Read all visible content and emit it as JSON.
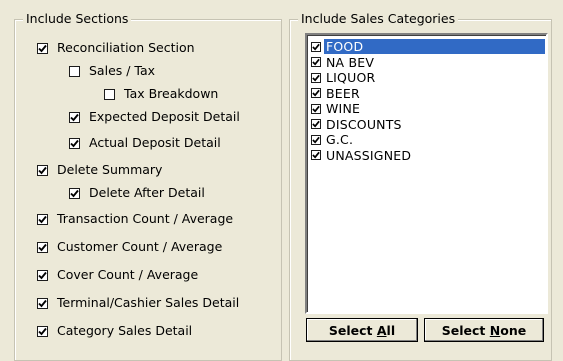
{
  "sections_group": {
    "title": "Include Sections",
    "items": [
      {
        "label": "Reconciliation Section",
        "checked": true
      },
      {
        "label": "Sales / Tax",
        "checked": false
      },
      {
        "label": "Tax Breakdown",
        "checked": false
      },
      {
        "label": "Expected Deposit Detail",
        "checked": true
      },
      {
        "label": "Actual Deposit Detail",
        "checked": true
      },
      {
        "label": "Delete Summary",
        "checked": true
      },
      {
        "label": "Delete After Detail",
        "checked": true
      },
      {
        "label": "Transaction Count / Average",
        "checked": true
      },
      {
        "label": "Customer Count / Average",
        "checked": true
      },
      {
        "label": "Cover Count / Average",
        "checked": true
      },
      {
        "label": "Terminal/Cashier Sales Detail",
        "checked": true
      },
      {
        "label": "Category Sales Detail",
        "checked": true
      }
    ]
  },
  "categories_group": {
    "title": "Include Sales Categories",
    "items": [
      {
        "label": "FOOD",
        "checked": true,
        "selected": true
      },
      {
        "label": "NA BEV",
        "checked": true
      },
      {
        "label": "LIQUOR",
        "checked": true
      },
      {
        "label": "BEER",
        "checked": true
      },
      {
        "label": "WINE",
        "checked": true
      },
      {
        "label": "DISCOUNTS",
        "checked": true
      },
      {
        "label": "G.C.",
        "checked": true
      },
      {
        "label": "UNASSIGNED",
        "checked": true
      }
    ],
    "select_all": {
      "prefix": "Select ",
      "mnemonic": "A",
      "suffix": "ll"
    },
    "select_none": {
      "prefix": "Select ",
      "mnemonic": "N",
      "suffix": "one"
    }
  },
  "colors": {
    "background": "#ece9d8",
    "selection": "#316ac5"
  },
  "icons": {
    "check": "checkmark-icon"
  }
}
